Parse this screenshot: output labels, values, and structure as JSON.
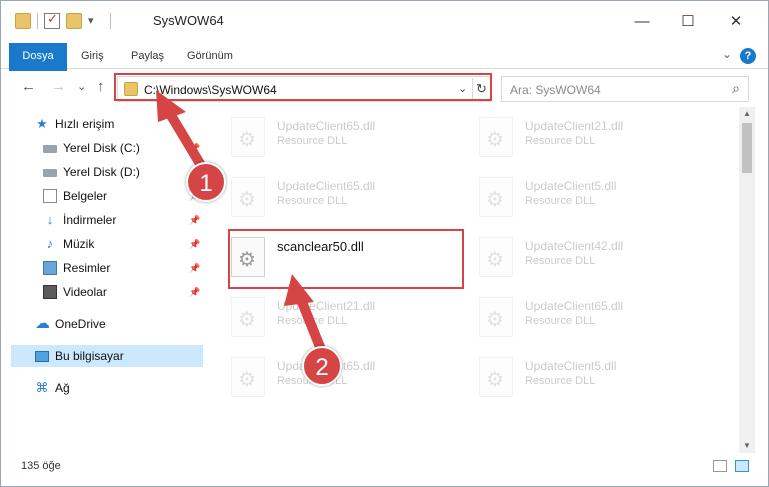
{
  "window": {
    "title": "SysWOW64",
    "controls": {
      "minimize": "—",
      "maximize": "☐",
      "close": "✕"
    }
  },
  "ribbon": {
    "tabs": [
      "Dosya",
      "Giriş",
      "Paylaş",
      "Görünüm"
    ],
    "help": "?"
  },
  "nav": {
    "back": "←",
    "forward": "→",
    "recent": "⌄",
    "up": "↑",
    "address": "C:\\Windows\\SysWOW64",
    "search_placeholder": "Ara: SysWOW64"
  },
  "sidebar": {
    "items": [
      {
        "label": "Hızlı erişim",
        "icon": "star-icon"
      },
      {
        "label": "Yerel Disk (C:)",
        "icon": "drive-icon",
        "pinned": true
      },
      {
        "label": "Yerel Disk (D:)",
        "icon": "drive-icon"
      },
      {
        "label": "Belgeler",
        "icon": "documents-icon",
        "pinned": true
      },
      {
        "label": "İndirmeler",
        "icon": "downloads-icon",
        "pinned": true
      },
      {
        "label": "Müzik",
        "icon": "music-icon",
        "pinned": true
      },
      {
        "label": "Resimler",
        "icon": "pictures-icon",
        "pinned": true
      },
      {
        "label": "Videolar",
        "icon": "videos-icon",
        "pinned": true
      },
      {
        "label": "OneDrive",
        "icon": "cloud-icon"
      },
      {
        "label": "Bu bilgisayar",
        "icon": "computer-icon",
        "selected": true
      },
      {
        "label": "Ağ",
        "icon": "network-icon"
      }
    ]
  },
  "files": [
    {
      "name": "UpdateClient65.dll",
      "type": "Resource DLL"
    },
    {
      "name": "UpdateClient21.dll",
      "type": "Resource DLL"
    },
    {
      "name": "UpdateClient65.dll",
      "type": "Resource DLL"
    },
    {
      "name": "UpdateClient5.dll",
      "type": "Resource DLL"
    },
    {
      "name": "scanclear50.dll",
      "type": ""
    },
    {
      "name": "UpdateClient42.dll",
      "type": "Resource DLL"
    },
    {
      "name": "UpdateClient21.dll",
      "type": "Resource DLL"
    },
    {
      "name": "UpdateClient65.dll",
      "type": "Resource DLL"
    },
    {
      "name": "UpdateClient65.dll",
      "type": "Resource DLL"
    },
    {
      "name": "UpdateClient5.dll",
      "type": "Resource DLL"
    }
  ],
  "status": {
    "count": "135 öğe"
  },
  "annotations": {
    "step1": "1",
    "step2": "2",
    "color": "#d64545"
  }
}
